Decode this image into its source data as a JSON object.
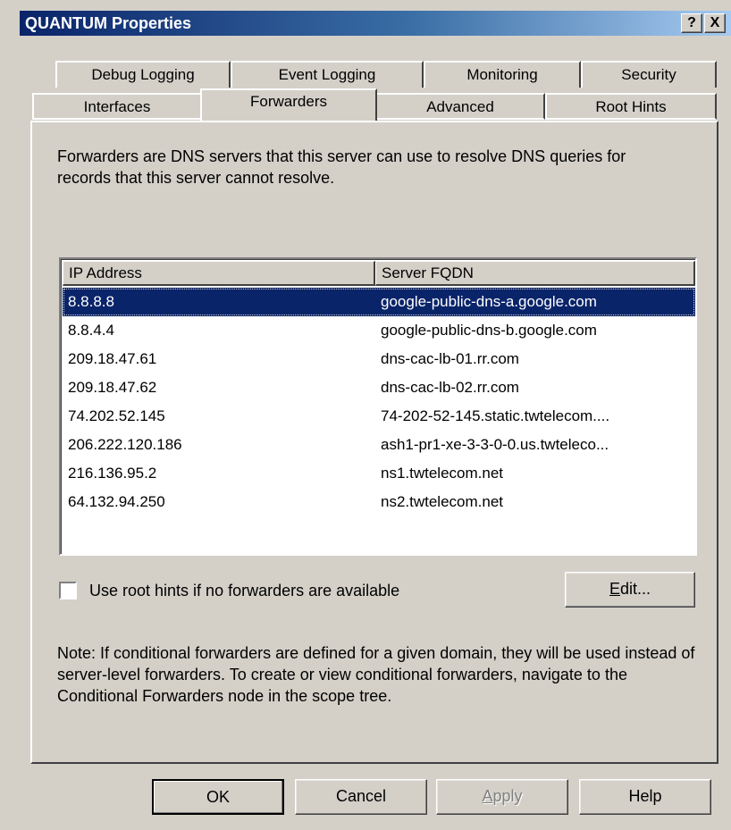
{
  "window": {
    "title": "QUANTUM Properties",
    "help_label": "?",
    "close_label": "X"
  },
  "tabs_row1": [
    {
      "label": "Debug Logging"
    },
    {
      "label": "Event Logging"
    },
    {
      "label": "Monitoring"
    },
    {
      "label": "Security"
    }
  ],
  "tabs_row2": [
    {
      "label": "Interfaces"
    },
    {
      "label": "Forwarders",
      "active": true
    },
    {
      "label": "Advanced"
    },
    {
      "label": "Root Hints"
    }
  ],
  "forwarders": {
    "intro": "Forwarders are DNS servers that this server can use to resolve DNS queries for records that this server cannot resolve.",
    "columns": [
      "IP Address",
      "Server FQDN"
    ],
    "rows": [
      {
        "ip": "8.8.8.8",
        "fqdn": "google-public-dns-a.google.com",
        "selected": true
      },
      {
        "ip": "8.8.4.4",
        "fqdn": "google-public-dns-b.google.com"
      },
      {
        "ip": "209.18.47.61",
        "fqdn": "dns-cac-lb-01.rr.com"
      },
      {
        "ip": "209.18.47.62",
        "fqdn": "dns-cac-lb-02.rr.com"
      },
      {
        "ip": "74.202.52.145",
        "fqdn": "74-202-52-145.static.twtelecom...."
      },
      {
        "ip": "206.222.120.186",
        "fqdn": "ash1-pr1-xe-3-3-0-0.us.twteleco..."
      },
      {
        "ip": "216.136.95.2",
        "fqdn": "ns1.twtelecom.net"
      },
      {
        "ip": "64.132.94.250",
        "fqdn": "ns2.twtelecom.net"
      }
    ],
    "root_hints_checkbox": {
      "label": "Use root hints if no forwarders are available",
      "checked": false
    },
    "edit_button": {
      "accel": "E",
      "rest": "dit..."
    },
    "note": "Note: If conditional forwarders are defined for a given domain, they will be used instead of server-level forwarders.  To create or view conditional forwarders, navigate to the Conditional Forwarders node in the scope tree."
  },
  "footer": {
    "ok_label": "OK",
    "cancel_label": "Cancel",
    "apply_accel": "A",
    "apply_rest": "pply",
    "help_label": "Help"
  },
  "colors": {
    "titlebar_start": "#0a246a",
    "titlebar_end": "#a6caf0",
    "selection": "#0a246a",
    "face": "#d4d0c8"
  }
}
